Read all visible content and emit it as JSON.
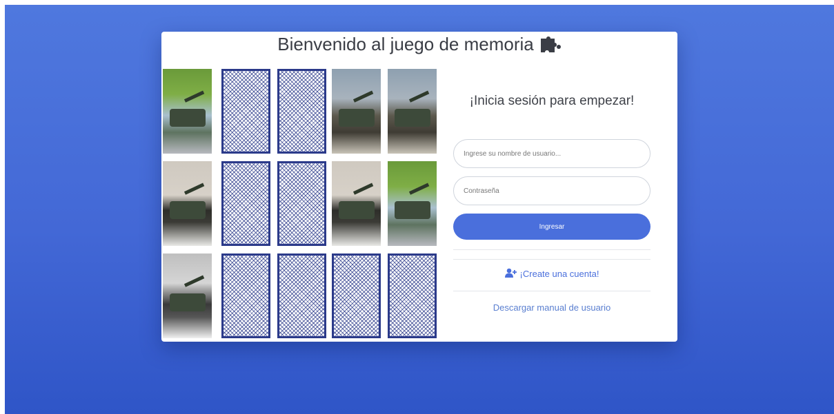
{
  "header": {
    "title": "Bienvenido al juego de memoria"
  },
  "icons": {
    "title_icon": "puzzle-piece-icon",
    "register_icon": "user-plus-icon"
  },
  "board": {
    "cards": [
      {
        "face": "up",
        "photo": "a"
      },
      {
        "face": "down"
      },
      {
        "face": "down"
      },
      {
        "face": "up",
        "photo": "b"
      },
      {
        "face": "up",
        "photo": "b"
      },
      {
        "face": "up",
        "photo": "c"
      },
      {
        "face": "down"
      },
      {
        "face": "down"
      },
      {
        "face": "up",
        "photo": "c"
      },
      {
        "face": "up",
        "photo": "a"
      },
      {
        "face": "up",
        "photo": "d"
      },
      {
        "face": "down"
      },
      {
        "face": "down"
      },
      {
        "face": "down"
      },
      {
        "face": "down"
      }
    ]
  },
  "login": {
    "subtitle": "¡Inicia sesión para empezar!",
    "username_placeholder": "Ingrese su nombre de usuario...",
    "password_placeholder": "Contraseña",
    "submit_label": "Ingresar",
    "register_label": "¡Create una cuenta!",
    "manual_label": "Descargar manual de usuario"
  },
  "colors": {
    "accent": "#4a6fdc",
    "card_back": "#2b3a8a",
    "background": "#4368d6"
  }
}
